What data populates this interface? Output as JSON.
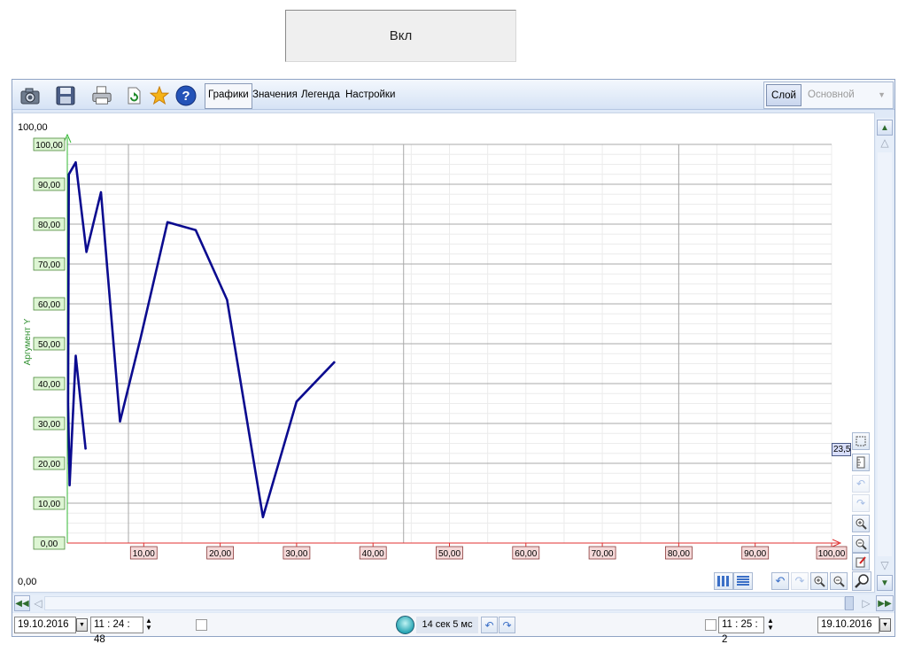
{
  "top_button": {
    "label": "Вкл"
  },
  "toolbar": {
    "icons": [
      "camera-icon",
      "save-icon",
      "print-icon",
      "refresh-icon",
      "star-icon",
      "help-icon"
    ],
    "tabs": [
      {
        "label": "Графики",
        "active": true
      },
      {
        "label": "Значения",
        "active": false
      },
      {
        "label": "Легенда",
        "active": false
      },
      {
        "label": "Настройки",
        "active": false
      }
    ],
    "layer_button": "Слой",
    "layer_value": "Основной"
  },
  "plot": {
    "y_top_label": "100,00",
    "y_bottom_label": "0,00",
    "cursor_value": "23,5",
    "colors": {
      "line": "#0b0b8f",
      "x_axis": "#e03030",
      "y_axis": "#33b833",
      "x_tick_bg": "#f5dada",
      "y_tick_bg": "#ddf5d3"
    }
  },
  "chart_data": {
    "type": "line",
    "title": "",
    "ylabel": "Аргумент Y",
    "xlabel": "",
    "xlim": [
      0,
      100
    ],
    "ylim": [
      0,
      100
    ],
    "grid": true,
    "x_ticks": [
      "10,00",
      "20,00",
      "30,00",
      "40,00",
      "50,00",
      "60,00",
      "70,00",
      "80,00",
      "90,00",
      "100,00"
    ],
    "y_ticks": [
      "0,00",
      "10,00",
      "20,00",
      "30,00",
      "40,00",
      "50,00",
      "60,00",
      "70,00",
      "80,00",
      "90,00",
      "100,00"
    ],
    "series": [
      {
        "points": [
          [
            2.4,
            23.5
          ],
          [
            1.1,
            47
          ],
          [
            0.3,
            14.5
          ],
          [
            0.1,
            35
          ],
          [
            0.2,
            92.5
          ],
          [
            1.1,
            95.5
          ],
          [
            2.5,
            73
          ],
          [
            4.4,
            88
          ],
          [
            6.9,
            30.5
          ],
          [
            9.6,
            51.5
          ],
          [
            13.1,
            80.5
          ],
          [
            16.8,
            78.5
          ],
          [
            20.9,
            61
          ],
          [
            25.6,
            6.5
          ],
          [
            30.0,
            35.5
          ],
          [
            35.0,
            45.5
          ]
        ]
      }
    ]
  },
  "statusbar": {
    "start_date": "19.10.2016",
    "start_time": "11 : 24 : 48",
    "duration": "14 сек 5 мс",
    "end_time": "11 : 25 : 2",
    "end_date": "19.10.2016"
  }
}
